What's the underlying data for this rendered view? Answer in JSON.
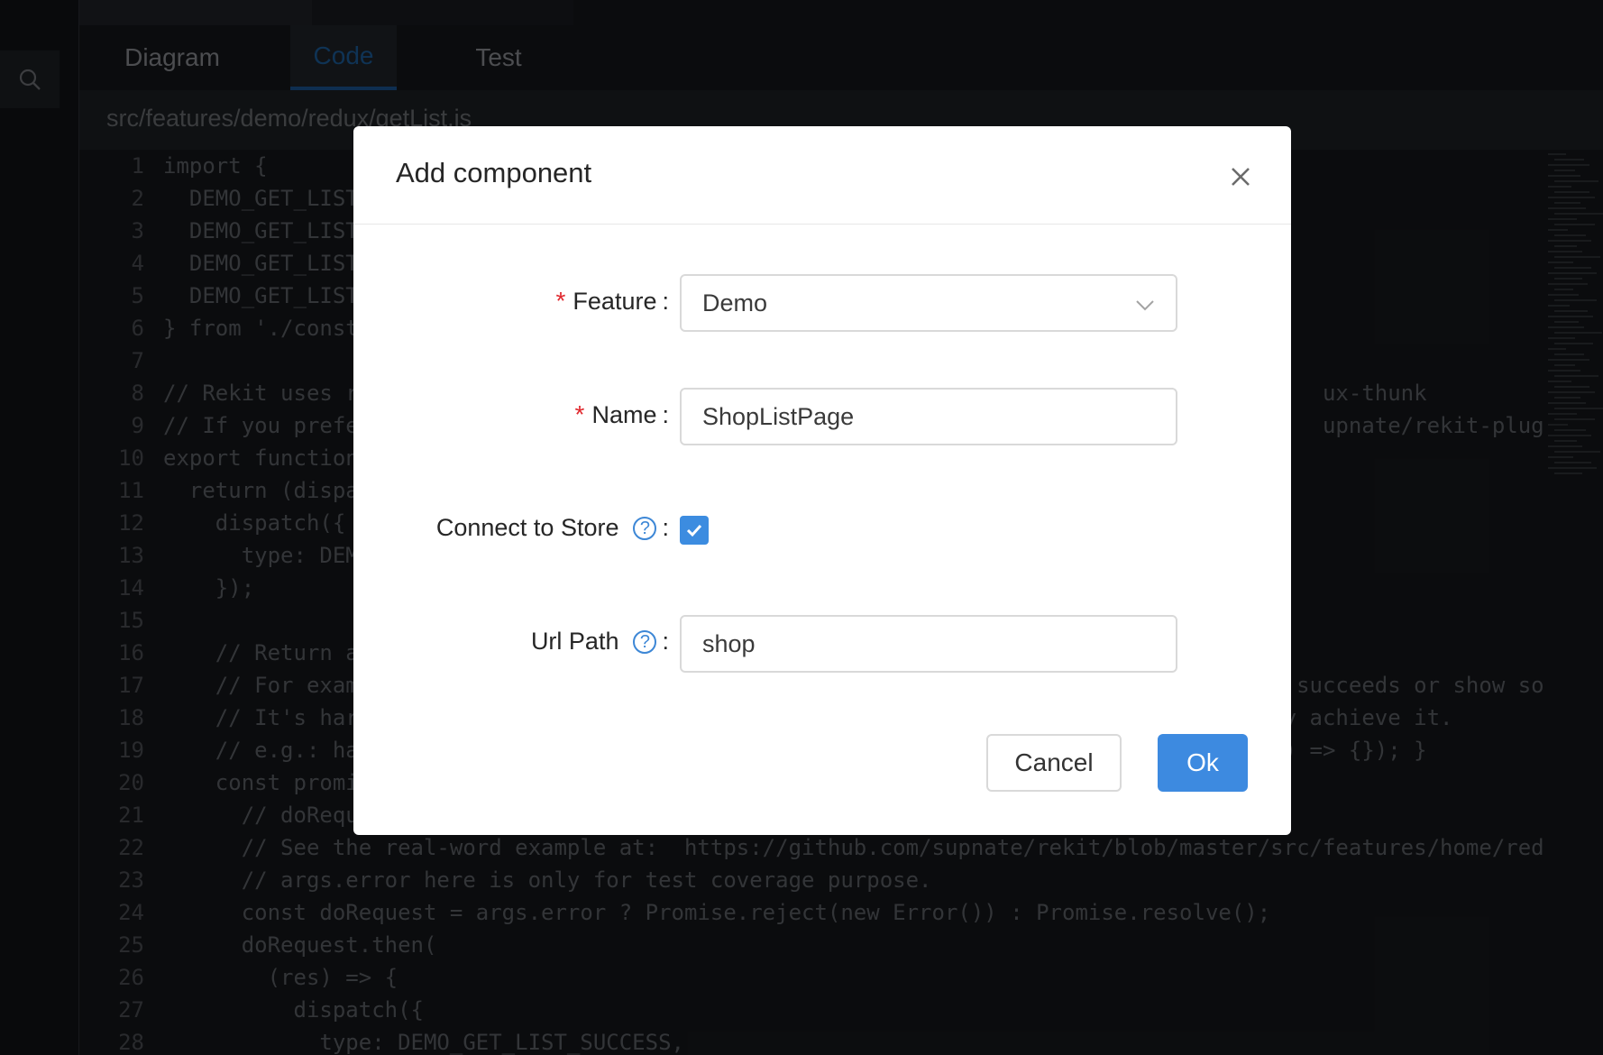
{
  "tabs": {
    "diagram": "Diagram",
    "code": "Code",
    "test": "Test"
  },
  "path": "src/features/demo/redux/getList.js",
  "code_lines": [
    {
      "n": "1",
      "t": "import {"
    },
    {
      "n": "2",
      "t": "  DEMO_GET_LIST"
    },
    {
      "n": "3",
      "t": "  DEMO_GET_LIST"
    },
    {
      "n": "4",
      "t": "  DEMO_GET_LIST"
    },
    {
      "n": "5",
      "t": "  DEMO_GET_LIST"
    },
    {
      "n": "6",
      "t": "} from './const"
    },
    {
      "n": "7",
      "t": ""
    },
    {
      "n": "8",
      "t": "// Rekit uses r                                                                          ux-thunk"
    },
    {
      "n": "9",
      "t": "// If you prefe                                                                          upnate/rekit-plugin-"
    },
    {
      "n": "10",
      "t": "export function"
    },
    {
      "n": "11",
      "t": "  return (dispa"
    },
    {
      "n": "12",
      "t": "    dispatch({"
    },
    {
      "n": "13",
      "t": "      type: DEM"
    },
    {
      "n": "14",
      "t": "    });"
    },
    {
      "n": "15",
      "t": ""
    },
    {
      "n": "16",
      "t": "    // Return a"
    },
    {
      "n": "17",
      "t": "    // For exam                                                                        succeeds or show so"
    },
    {
      "n": "18",
      "t": "    // It's har                                                                       y achieve it."
    },
    {
      "n": "19",
      "t": "    // e.g.: ha                                                                       ) => {}); }"
    },
    {
      "n": "20",
      "t": "    const promi"
    },
    {
      "n": "21",
      "t": "      // doRequ"
    },
    {
      "n": "22",
      "t": "      // See the real-word example at:  https://github.com/supnate/rekit/blob/master/src/features/home/red"
    },
    {
      "n": "23",
      "t": "      // args.error here is only for test coverage purpose."
    },
    {
      "n": "24",
      "t": "      const doRequest = args.error ? Promise.reject(new Error()) : Promise.resolve();"
    },
    {
      "n": "25",
      "t": "      doRequest.then("
    },
    {
      "n": "26",
      "t": "        (res) => {"
    },
    {
      "n": "27",
      "t": "          dispatch({"
    },
    {
      "n": "28",
      "t": "            type: DEMO_GET_LIST_SUCCESS,"
    }
  ],
  "modal": {
    "title": "Add component",
    "feature_label": "Feature",
    "feature_value": "Demo",
    "name_label": "Name",
    "name_value": "ShopListPage",
    "connect_label": "Connect to Store",
    "connect_checked": true,
    "urlpath_label": "Url Path",
    "urlpath_value": "shop",
    "required_mark": "*",
    "help_mark": "?",
    "colon": ":",
    "cancel_label": "Cancel",
    "ok_label": "Ok"
  },
  "colors": {
    "primary": "#3d8ae0",
    "required": "#e0282e",
    "tab_active": "#1d5d9b"
  },
  "icons": {
    "search": "search-icon",
    "close": "close-icon",
    "dropdown": "chevron-down-icon",
    "check": "check-icon",
    "help": "question-circle-icon"
  }
}
